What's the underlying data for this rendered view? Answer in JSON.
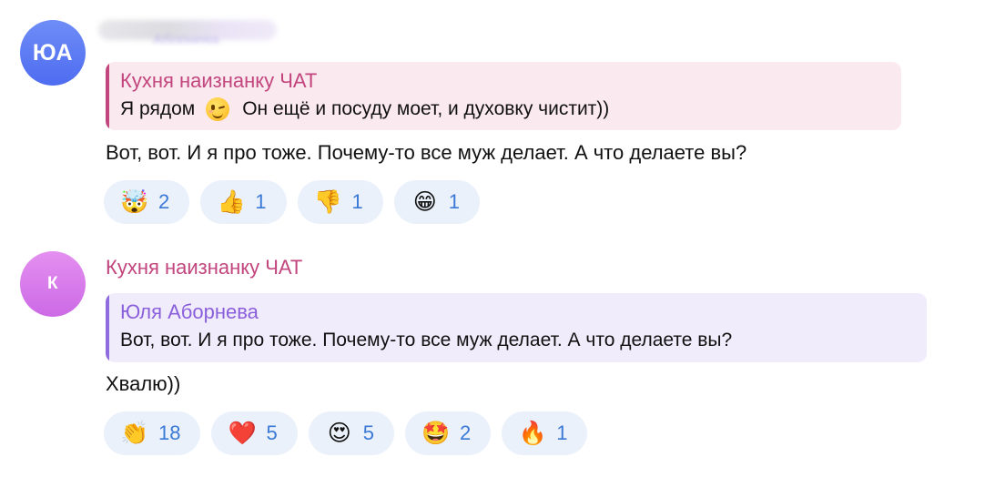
{
  "messages": [
    {
      "avatar_initials": "ЮА",
      "avatar_color": "#5b78f2",
      "sender_name_fragment": "Аборнева",
      "quote": {
        "author": "Кухня наизнанку ЧАТ",
        "text_before_emoji": "Я рядом",
        "emoji_icon": "winking-face-icon",
        "text_after_emoji": "Он ещё и посуду моет, и духовку чистит))"
      },
      "text": "Вот, вот. И я про тоже. Почему-то все муж делает. А что делаете вы?",
      "reactions": [
        {
          "emoji": "🤯",
          "icon": "exploding-head-icon",
          "count": "2"
        },
        {
          "emoji": "👍",
          "icon": "thumbs-up-icon",
          "count": "1"
        },
        {
          "emoji": "👎",
          "icon": "thumbs-down-icon",
          "count": "1"
        },
        {
          "emoji": "😁",
          "icon": "grinning-face-icon",
          "count": "1"
        }
      ]
    },
    {
      "avatar_initials": "К",
      "avatar_color": "#d77ce9",
      "sender_name": "Кухня наизнанку ЧАТ",
      "quote": {
        "author": "Юля Аборнева",
        "text": "Вот, вот. И я про тоже. Почему-то все муж делает. А что делаете вы?"
      },
      "text": "Хвалю))",
      "reactions": [
        {
          "emoji": "👏",
          "icon": "clapping-hands-icon",
          "count": "18"
        },
        {
          "emoji": "❤️",
          "icon": "red-heart-icon",
          "count": "5"
        },
        {
          "emoji": "😍",
          "icon": "heart-eyes-icon",
          "count": "5"
        },
        {
          "emoji": "🤩",
          "icon": "star-struck-icon",
          "count": "2"
        },
        {
          "emoji": "🔥",
          "icon": "fire-icon",
          "count": "1"
        }
      ]
    }
  ],
  "colors": {
    "accent_pink": "#c2457d",
    "accent_purple": "#8a5fdb",
    "reaction_bg": "#eaf1fb",
    "reaction_count": "#3a79d6"
  }
}
